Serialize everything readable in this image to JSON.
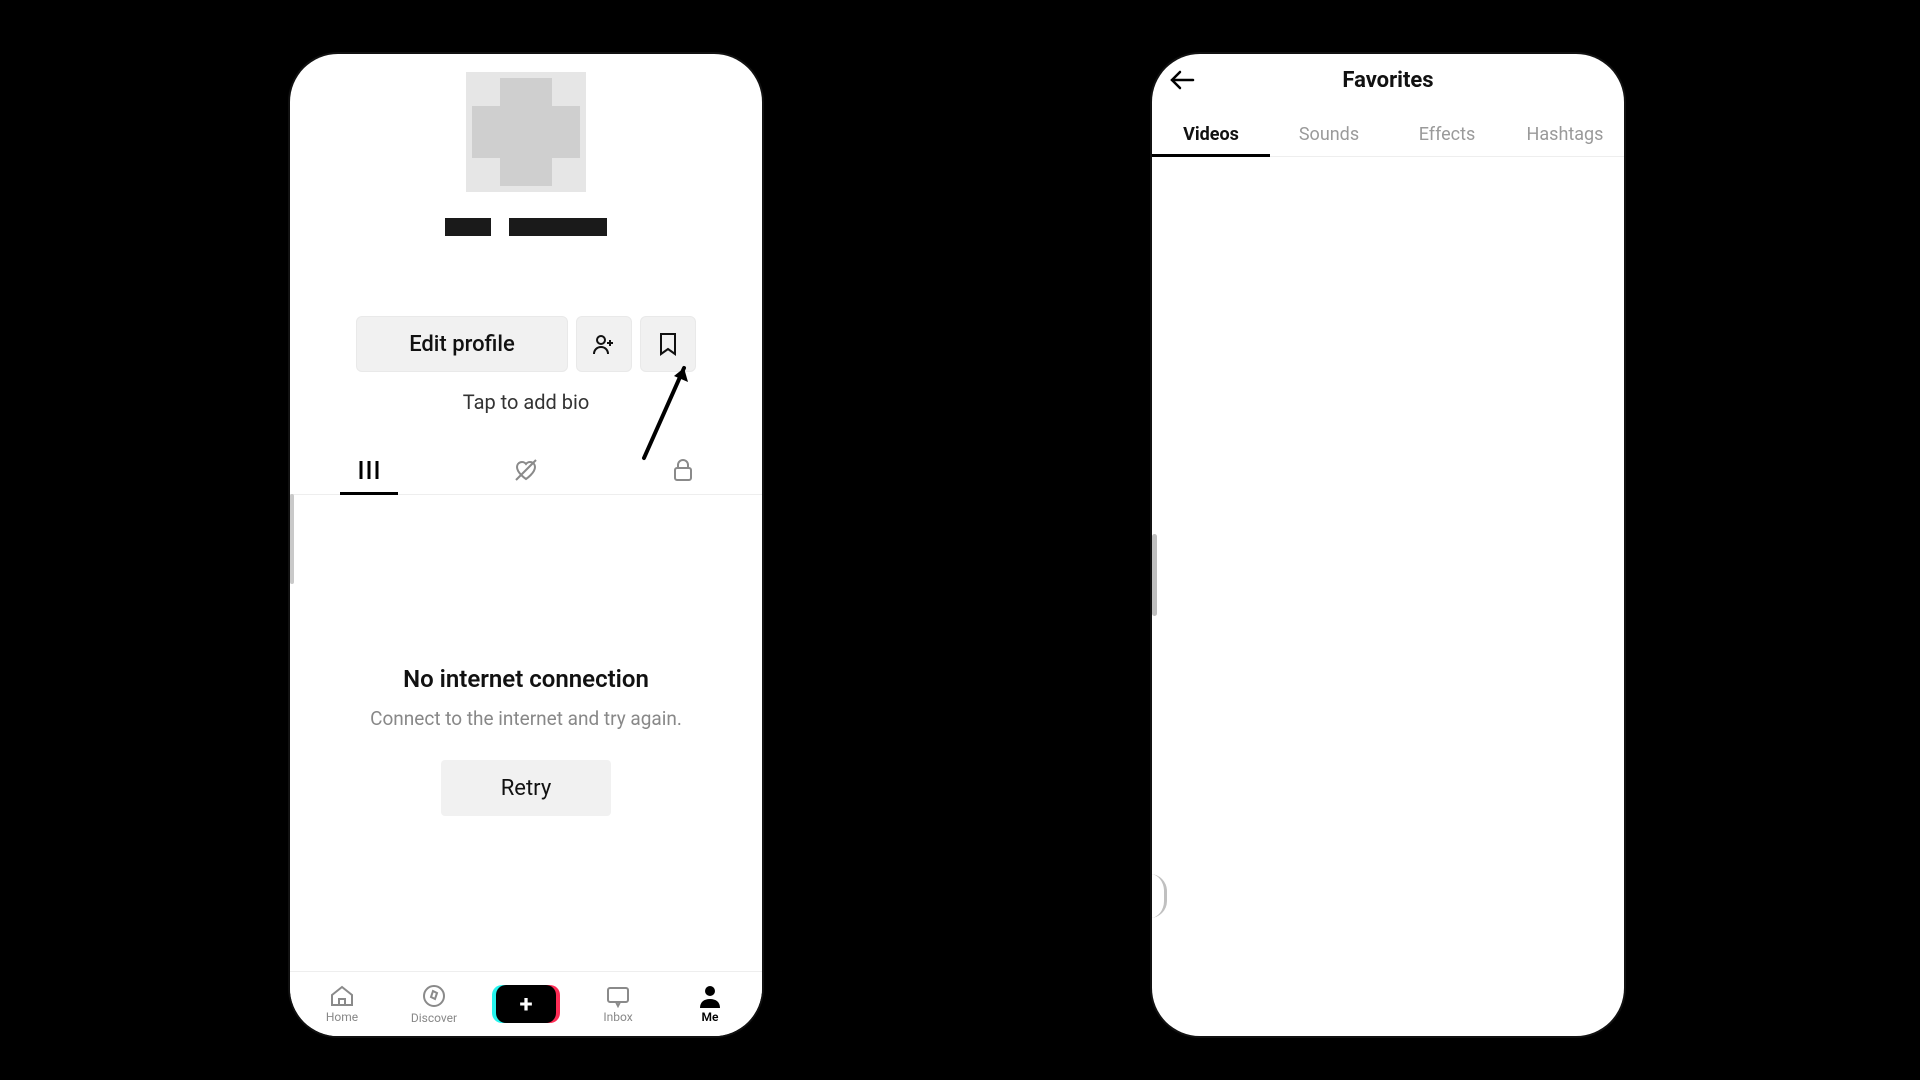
{
  "left": {
    "edit_label": "Edit profile",
    "bio_placeholder": "Tap to add bio",
    "empty_title": "No internet connection",
    "empty_subtitle": "Connect to the internet and try again.",
    "retry_label": "Retry",
    "nav": {
      "home": "Home",
      "discover": "Discover",
      "inbox": "Inbox",
      "me": "Me"
    },
    "profile_tabs": [
      "posts",
      "liked",
      "private"
    ]
  },
  "right": {
    "title": "Favorites",
    "tabs": {
      "videos": "Videos",
      "sounds": "Sounds",
      "effects": "Effects",
      "hashtags": "Hashtags"
    },
    "active_tab": "videos"
  }
}
